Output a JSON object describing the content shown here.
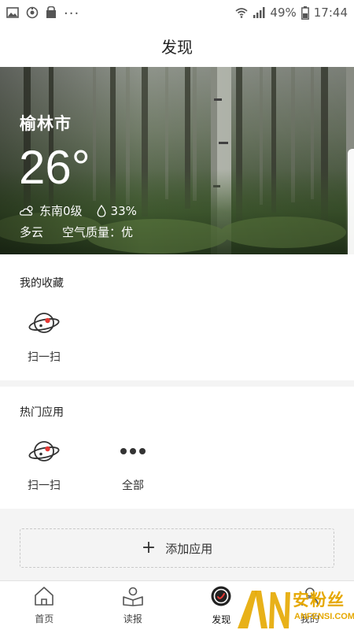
{
  "status_bar": {
    "left_icons": [
      "image-icon",
      "sync-icon",
      "bag-icon"
    ],
    "more": "...",
    "battery": "49%",
    "time": "17:44"
  },
  "header": {
    "title": "发现"
  },
  "weather": {
    "city": "榆林市",
    "temperature": "26°",
    "wind": "东南0级",
    "humidity": "33%",
    "condition": "多云",
    "air_quality": "空气质量：优"
  },
  "favorites": {
    "title": "我的收藏",
    "items": [
      {
        "label": "扫一扫",
        "icon": "planet-icon"
      }
    ]
  },
  "hot_apps": {
    "title": "热门应用",
    "items": [
      {
        "label": "扫一扫",
        "icon": "planet-icon"
      },
      {
        "label": "全部",
        "icon": "more-dots-icon"
      }
    ]
  },
  "add_app": {
    "label": "添加应用"
  },
  "bottom_nav": {
    "items": [
      {
        "label": "首页",
        "icon": "home-icon"
      },
      {
        "label": "读报",
        "icon": "read-icon"
      },
      {
        "label": "发现",
        "icon": "discover-icon",
        "active": true
      },
      {
        "label": "我的",
        "icon": "profile-icon"
      }
    ]
  },
  "watermark": {
    "text": "安粉丝",
    "sub": "ANFENSI.COM"
  },
  "colors": {
    "accent": "#e53935",
    "watermark": "#e6a800"
  }
}
